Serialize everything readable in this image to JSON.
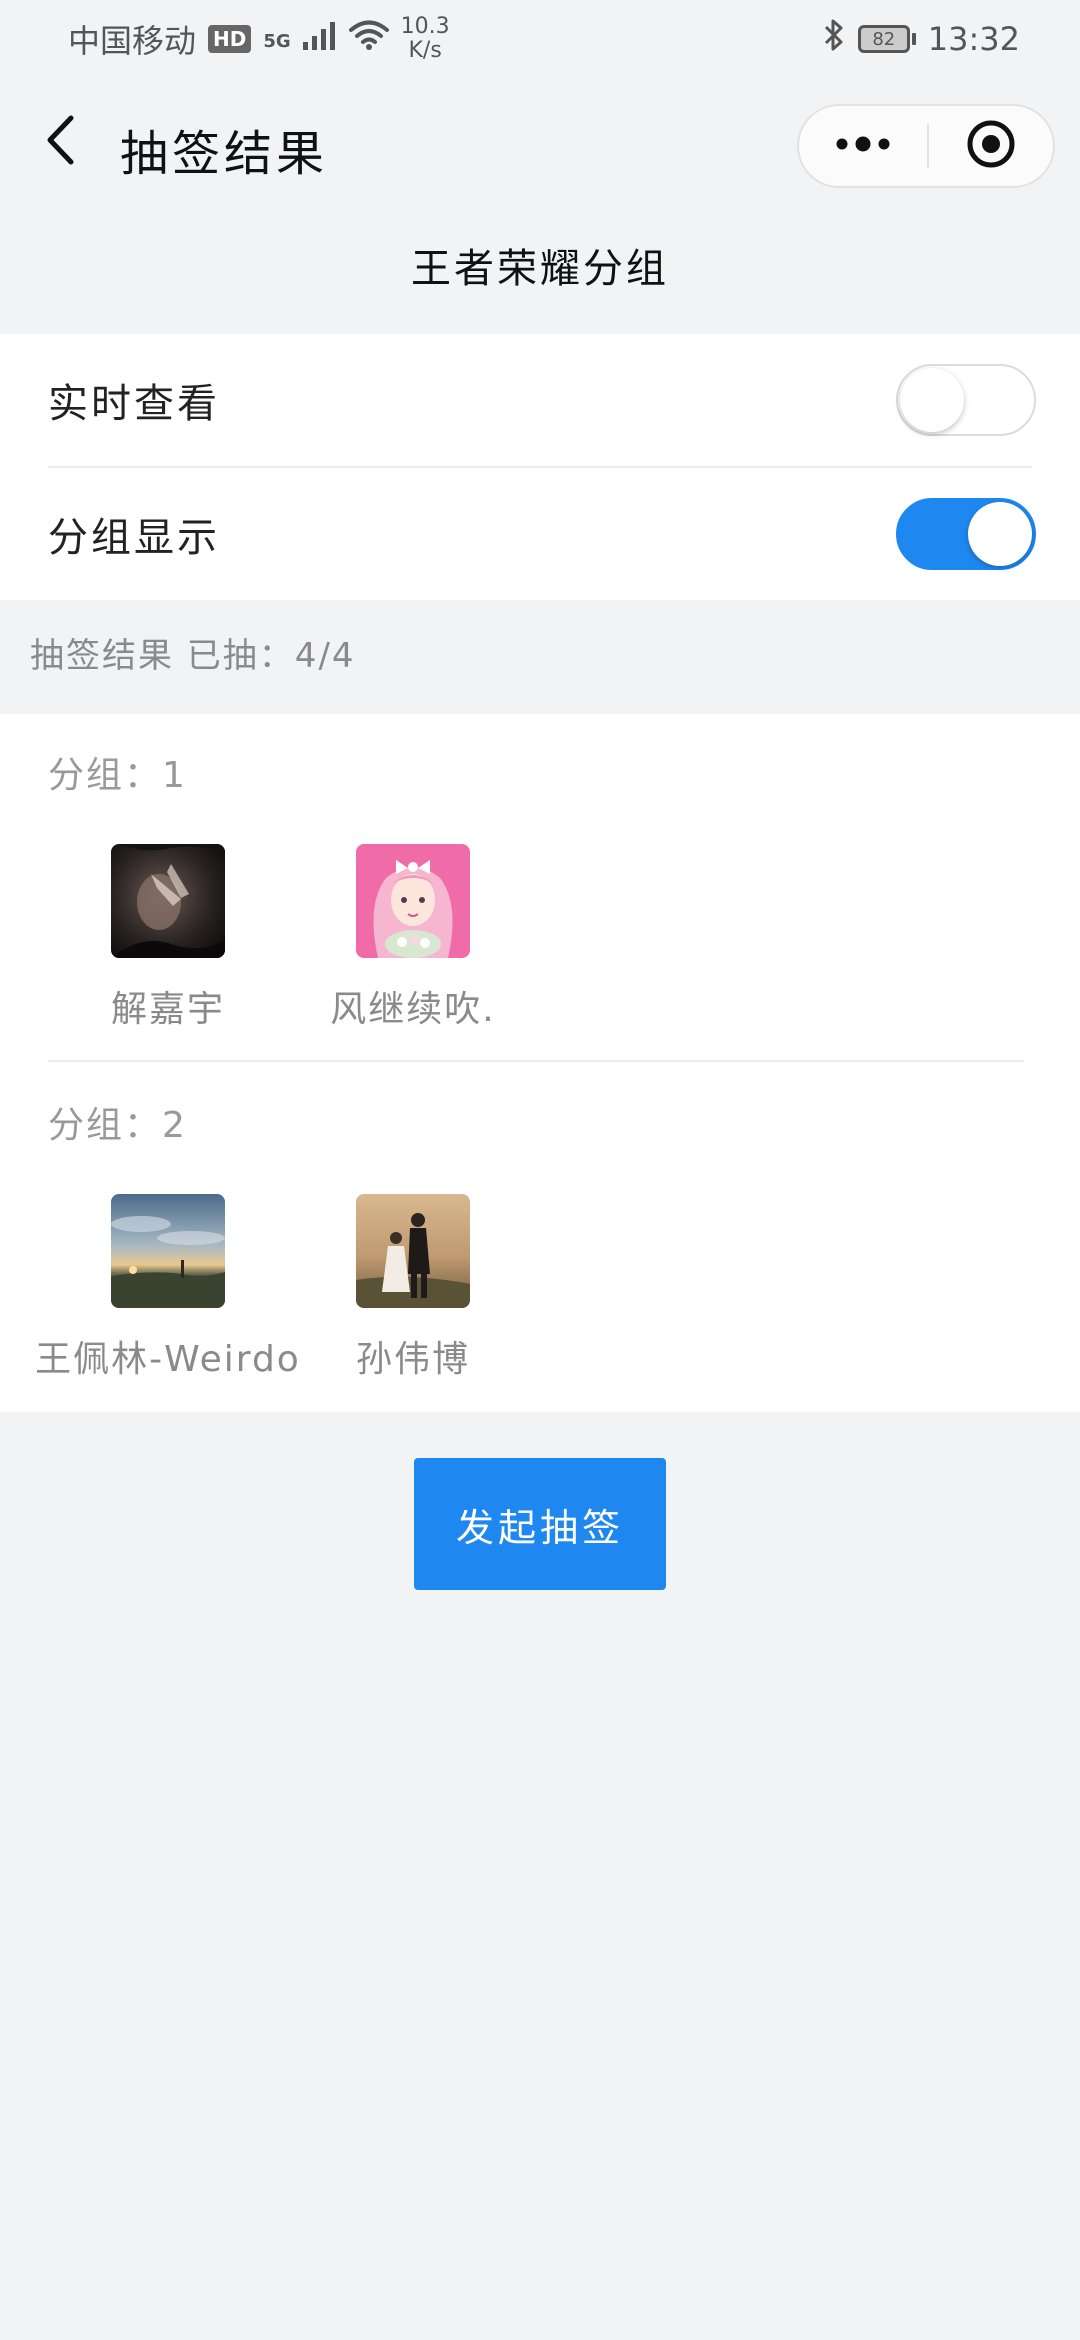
{
  "status_bar": {
    "carrier": "中国移动",
    "hd_badge": "HD",
    "network_type": "5G",
    "speed_value": "10.3",
    "speed_unit": "K/s",
    "battery_level": "82",
    "time": "13:32",
    "icons": [
      "signal-icon",
      "wifi-icon",
      "bluetooth-icon",
      "battery-icon"
    ]
  },
  "nav": {
    "title": "抽签结果",
    "back_icon": "chevron-left-icon",
    "more_icon": "more-dots-icon",
    "close_icon": "target-close-icon"
  },
  "sub_title": "王者荣耀分组",
  "settings": {
    "realtime_label": "实时查看",
    "realtime_on": false,
    "group_display_label": "分组显示",
    "group_display_on": true
  },
  "result_header": "抽签结果 已抽：4/4",
  "groups": [
    {
      "label": "分组：1",
      "members": [
        {
          "name": "解嘉宇",
          "avatar": "dark-portrait-avatar"
        },
        {
          "name": "风继续吹.",
          "avatar": "pink-anime-girl-avatar"
        }
      ]
    },
    {
      "label": "分组：2",
      "members": [
        {
          "name": "王佩林-Weirdo",
          "avatar": "sunset-landscape-avatar"
        },
        {
          "name": "孙伟博",
          "avatar": "couple-photo-avatar"
        }
      ]
    }
  ],
  "draw_button_label": "发起抽签",
  "colors": {
    "accent": "#1e88f0",
    "background": "#f2f3f5",
    "card": "#ffffff",
    "muted_text": "#8a8a8a"
  }
}
